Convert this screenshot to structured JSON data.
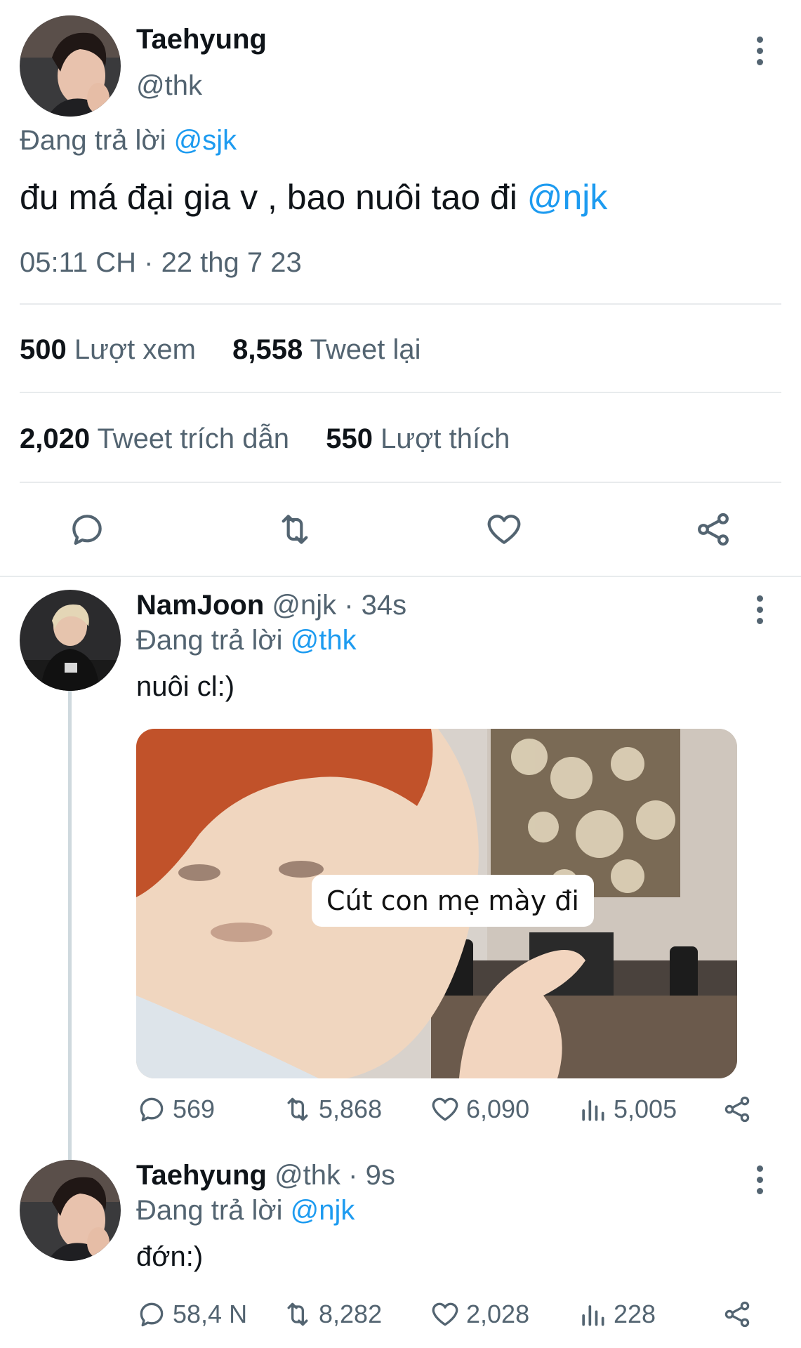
{
  "main_tweet": {
    "display_name": "Taehyung",
    "handle": "@thk",
    "reply_prefix": "Đang trả lời",
    "reply_to": "@sjk",
    "text": "đu má đại gia v , bao nuôi tao đi",
    "mention": "@njk",
    "timestamp": "05:11 CH · 22 thg 7 23",
    "stats": {
      "views_count": "500",
      "views_label": "Lượt xem",
      "retweets_count": "8,558",
      "retweets_label": "Tweet lại",
      "quotes_count": "2,020",
      "quotes_label": "Tweet trích dẫn",
      "likes_count": "550",
      "likes_label": "Lượt thích"
    }
  },
  "reply1": {
    "display_name": "NamJoon",
    "handle": "@njk",
    "time": "· 34s",
    "reply_prefix": "Đang trả lời",
    "reply_to": "@thk",
    "text": "nuôi cl:)",
    "media_caption": "Cút con mẹ mày đi",
    "actions": {
      "replies": "569",
      "retweets": "5,868",
      "likes": "6,090",
      "views": "5,005"
    }
  },
  "reply2": {
    "display_name": "Taehyung",
    "handle": "@thk",
    "time": "· 9s",
    "reply_prefix": "Đang trả lời",
    "reply_to": "@njk",
    "text": "đớn:)",
    "actions": {
      "replies": "58,4 N",
      "retweets": "8,282",
      "likes": "2,028",
      "views": "228"
    }
  },
  "icons": [
    "more-icon",
    "reply-icon",
    "retweet-icon",
    "like-icon",
    "share-icon",
    "views-icon"
  ],
  "colors": {
    "accent": "#1d9bf0",
    "text": "#0f1419",
    "secondary": "#536471",
    "divider": "#e8ebed"
  }
}
